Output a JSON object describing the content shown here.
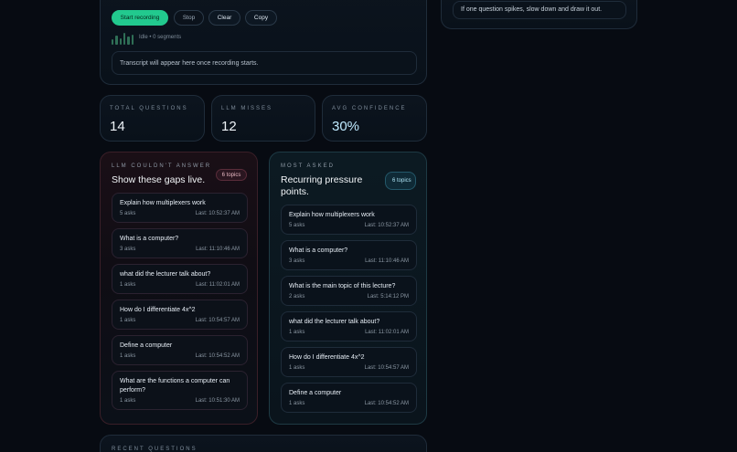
{
  "recorder": {
    "start_label": "Start recording",
    "stop_label": "Stop",
    "clear_label": "Clear",
    "copy_label": "Copy",
    "status": "Idle • 0 segments",
    "transcript_placeholder": "Transcript will appear here once recording starts."
  },
  "tip": "If one question spikes, slow down and draw it out.",
  "stats": [
    {
      "label": "TOTAL QUESTIONS",
      "value": "14"
    },
    {
      "label": "LLM MISSES",
      "value": "12"
    },
    {
      "label": "AVG CONFIDENCE",
      "value": "30%"
    }
  ],
  "gaps": {
    "eyebrow": "LLM COULDN'T ANSWER",
    "heading": "Show these gaps live.",
    "count": "6 topics",
    "items": [
      {
        "q": "Explain how multiplexers work",
        "asks": "5 asks",
        "last": "Last: 10:52:37 AM"
      },
      {
        "q": "What is a computer?",
        "asks": "3 asks",
        "last": "Last: 11:10:46 AM"
      },
      {
        "q": "what did the lecturer talk about?",
        "asks": "1 asks",
        "last": "Last: 11:02:01 AM"
      },
      {
        "q": "How do I differentiate 4x^2",
        "asks": "1 asks",
        "last": "Last: 10:54:57 AM"
      },
      {
        "q": "Define a computer",
        "asks": "1 asks",
        "last": "Last: 10:54:52 AM"
      },
      {
        "q": "What are the functions a computer can perform?",
        "asks": "1 asks",
        "last": "Last: 10:51:30 AM"
      }
    ]
  },
  "most": {
    "eyebrow": "MOST ASKED",
    "heading": "Recurring pressure points.",
    "count": "6 topics",
    "items": [
      {
        "q": "Explain how multiplexers work",
        "asks": "5 asks",
        "last": "Last: 10:52:37 AM"
      },
      {
        "q": "What is a computer?",
        "asks": "3 asks",
        "last": "Last: 11:10:46 AM"
      },
      {
        "q": "What is the main topic of this lecture?",
        "asks": "2 asks",
        "last": "Last: 5:14:12 PM"
      },
      {
        "q": "what did the lecturer talk about?",
        "asks": "1 asks",
        "last": "Last: 11:02:01 AM"
      },
      {
        "q": "How do I differentiate 4x^2",
        "asks": "1 asks",
        "last": "Last: 10:54:57 AM"
      },
      {
        "q": "Define a computer",
        "asks": "1 asks",
        "last": "Last: 10:54:52 AM"
      }
    ]
  },
  "recent": {
    "label": "RECENT QUESTIONS"
  },
  "colors": {
    "accent": "#22c98e",
    "background": "#070b12",
    "gaps_border": "#3a1f28",
    "most_border": "#1e3a44"
  }
}
